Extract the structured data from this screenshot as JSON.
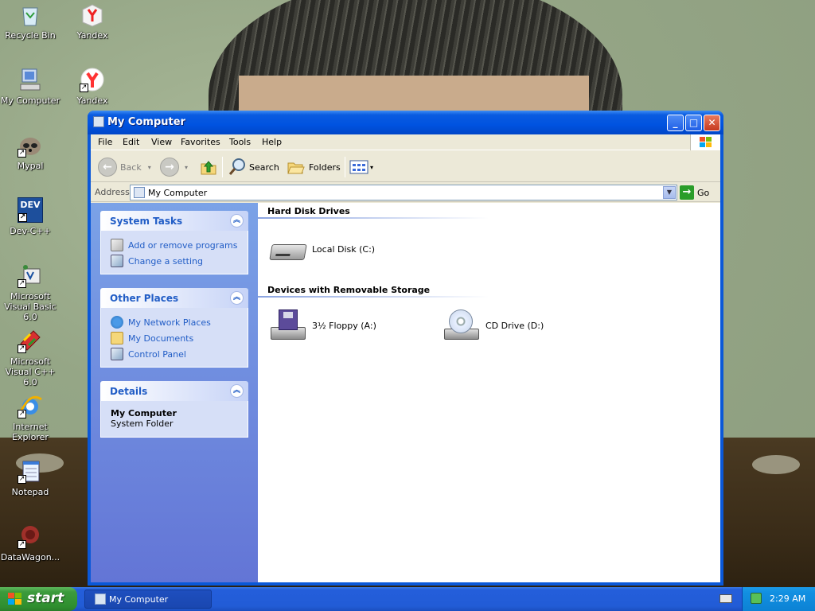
{
  "desktop": {
    "icons": [
      {
        "label": "Recycle Bin"
      },
      {
        "label": "Yandex"
      },
      {
        "label": "My Computer"
      },
      {
        "label": "Yandex"
      },
      {
        "label": "Mypal"
      },
      {
        "label": "Dev-C++"
      },
      {
        "label": "Microsoft Visual Basic 6.0"
      },
      {
        "label": "Microsoft Visual C++ 6.0"
      },
      {
        "label": "Internet Explorer"
      },
      {
        "label": "Notepad"
      },
      {
        "label": "DataWagon..."
      }
    ],
    "dev_icon_text": "DEV"
  },
  "window": {
    "title": "My Computer",
    "controls": {
      "minimize": "_",
      "maximize": "□",
      "close": "✕"
    },
    "menu": [
      "File",
      "Edit",
      "View",
      "Favorites",
      "Tools",
      "Help"
    ],
    "toolbar": {
      "back": "Back",
      "forward_glyph": "→",
      "back_glyph": "←",
      "up_glyph": "↑",
      "search": "Search",
      "folders": "Folders",
      "dropdown_glyph": "▾"
    },
    "address": {
      "label": "Address",
      "value": "My Computer",
      "go": "Go",
      "dropdown_glyph": "▼",
      "go_glyph": "→"
    },
    "task_pane": {
      "system_tasks": {
        "title": "System Tasks",
        "items": [
          "Add or remove programs",
          "Change a setting"
        ]
      },
      "other_places": {
        "title": "Other Places",
        "items": [
          "My Network Places",
          "My Documents",
          "Control Panel"
        ]
      },
      "details": {
        "title": "Details",
        "name": "My Computer",
        "type": "System Folder"
      },
      "collapse_glyph": "︽"
    },
    "content": {
      "groups": [
        {
          "heading": "Hard Disk Drives",
          "items": [
            "Local Disk (C:)"
          ]
        },
        {
          "heading": "Devices with Removable Storage",
          "items": [
            "3½ Floppy (A:)",
            "CD Drive (D:)"
          ]
        }
      ]
    }
  },
  "taskbar": {
    "start": "start",
    "task_button": "My Computer",
    "clock": "2:29 AM"
  },
  "colors": {
    "title_blue": "#0053e0",
    "taskpane_link": "#215dc6",
    "start_green": "#3c9b3c",
    "tray_blue": "#0c82d4"
  }
}
